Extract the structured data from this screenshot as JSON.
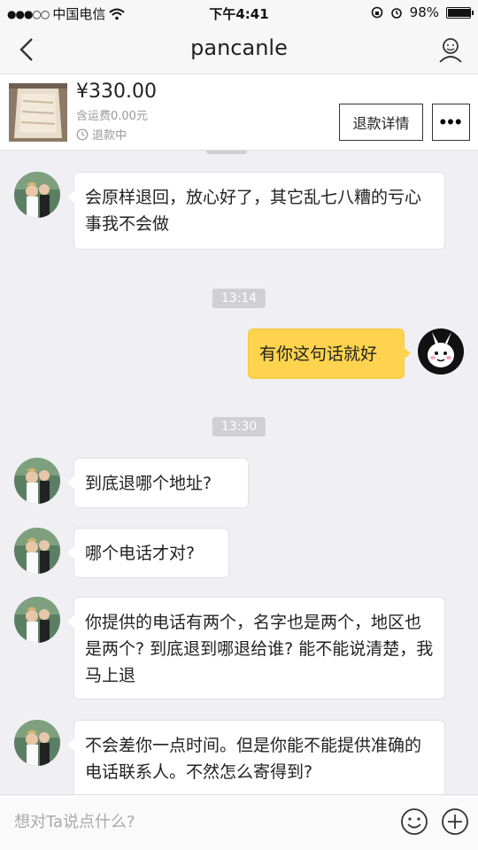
{
  "status_bar": {
    "carrier": "中国电信",
    "time": "下午4:41",
    "battery": "98%",
    "battery_level": 0.98
  },
  "nav": {
    "title": "pancanle"
  },
  "product": {
    "price": "¥330.00",
    "shipping": "含运费0.00元",
    "status": "退款中",
    "refund_button": "退款详情",
    "more_button": "•••"
  },
  "chat": {
    "messages": [
      {
        "side": "in",
        "text": "会原样退回，放心好了，其它乱七八糟的亏心事我不会做"
      },
      {
        "time": "13:14"
      },
      {
        "side": "out",
        "text": "有你这句话就好"
      },
      {
        "time": "13:30"
      },
      {
        "side": "in",
        "text": "到底退哪个地址?"
      },
      {
        "side": "in",
        "text": "哪个电话才对?"
      },
      {
        "side": "in",
        "text": "你提供的电话有两个，名字也是两个，地区也是两个? 到底退到哪退给谁? 能不能说清楚，我马上退"
      },
      {
        "side": "in",
        "text": "不会差你一点时间。但是你能不能提供准确的电话联系人。不然怎么寄得到?"
      }
    ]
  },
  "input": {
    "placeholder": "想对Ta说点什么?"
  }
}
